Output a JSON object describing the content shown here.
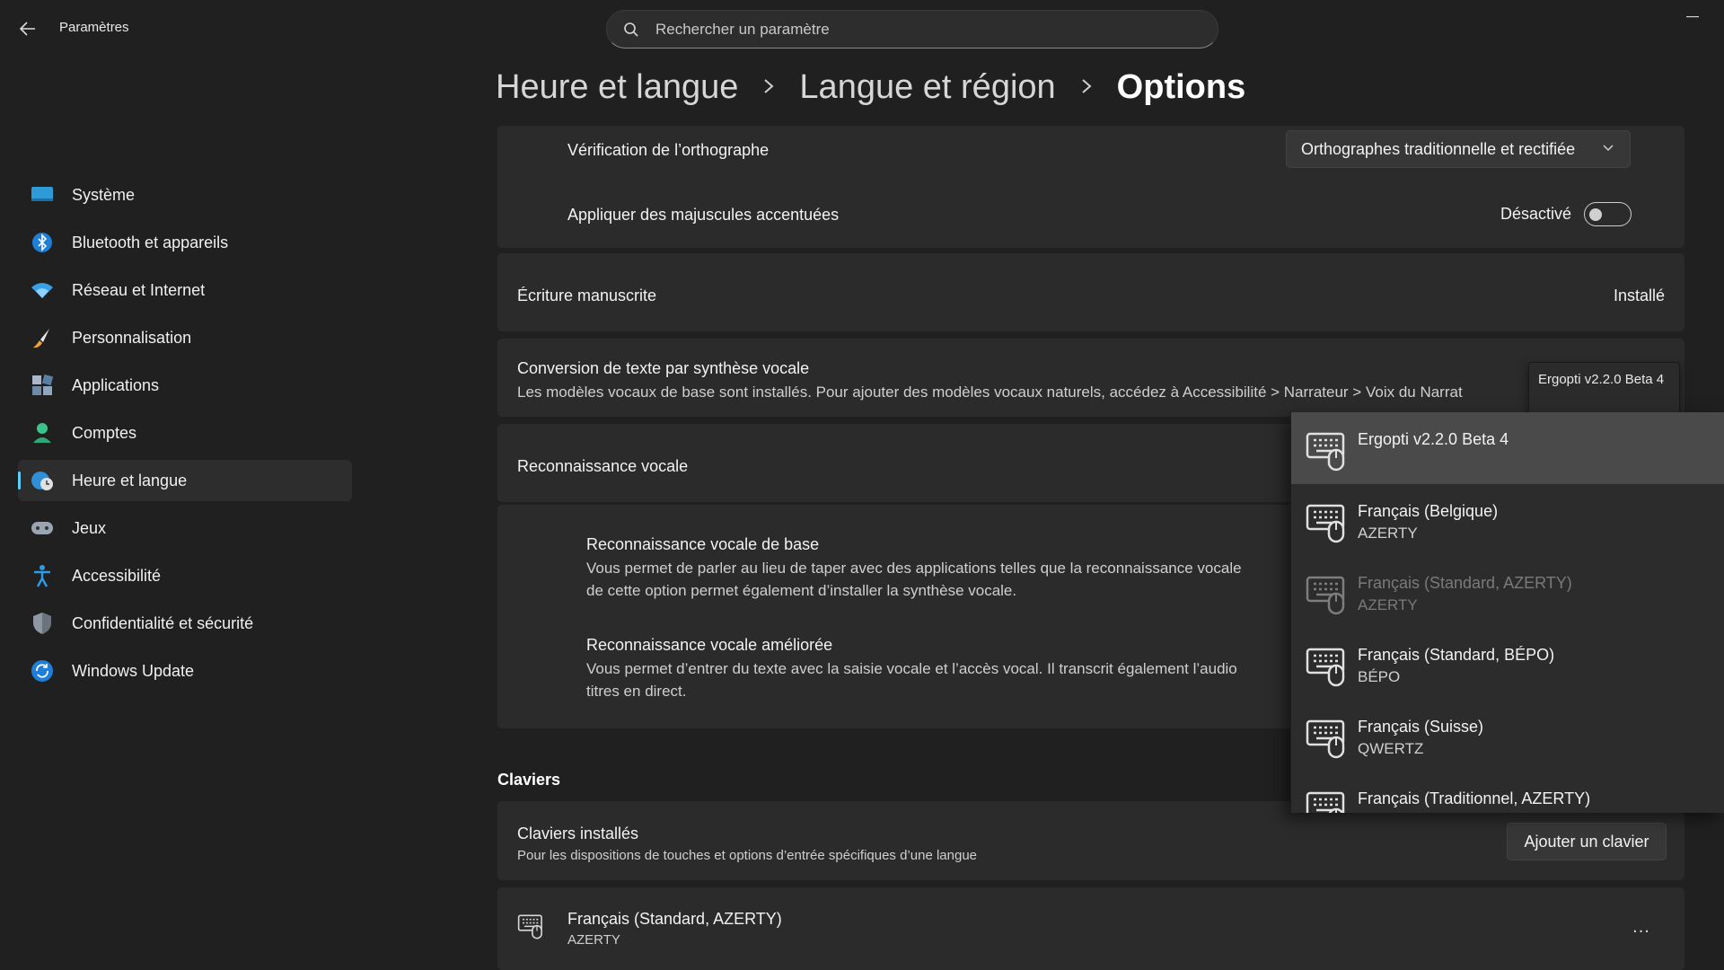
{
  "app": {
    "title": "Paramètres"
  },
  "search": {
    "placeholder": "Rechercher un paramètre"
  },
  "sidebar": {
    "items": [
      {
        "label": "Système",
        "icon": "monitor-icon"
      },
      {
        "label": "Bluetooth et appareils",
        "icon": "bluetooth-icon"
      },
      {
        "label": "Réseau et Internet",
        "icon": "wifi-icon"
      },
      {
        "label": "Personnalisation",
        "icon": "brush-icon"
      },
      {
        "label": "Applications",
        "icon": "apps-icon"
      },
      {
        "label": "Comptes",
        "icon": "user-icon"
      },
      {
        "label": "Heure et langue",
        "icon": "globe-clock-icon",
        "active": true
      },
      {
        "label": "Jeux",
        "icon": "gamepad-icon"
      },
      {
        "label": "Accessibilité",
        "icon": "accessibility-icon"
      },
      {
        "label": "Confidentialité et sécurité",
        "icon": "shield-icon"
      },
      {
        "label": "Windows Update",
        "icon": "update-icon"
      }
    ]
  },
  "breadcrumb": {
    "level1": "Heure et langue",
    "level2": "Langue et région",
    "current": "Options"
  },
  "spellcheck": {
    "label": "Vérification de l’orthographe",
    "value": "Orthographes traditionnelle et rectifiée"
  },
  "accented_caps": {
    "label": "Appliquer des majuscules accentuées",
    "state": "Désactivé",
    "on": false
  },
  "handwriting": {
    "label": "Écriture manuscrite",
    "status": "Installé"
  },
  "tts": {
    "label": "Conversion de texte par synthèse vocale",
    "desc": "Les modèles vocaux de base sont installés. Pour ajouter des modèles vocaux naturels, accédez à Accessibilité > Narrateur > Voix du Narrat"
  },
  "speech": {
    "label": "Reconnaissance vocale",
    "basic": {
      "title": "Reconnaissance vocale de base",
      "line1": "Vous permet de parler au lieu de taper avec des applications telles que la reconnaissance vocale",
      "line2": "de cette option permet également d’installer la synthèse vocale."
    },
    "enhanced": {
      "title": "Reconnaissance vocale améliorée",
      "line1": "Vous permet d’entrer du texte avec la saisie vocale et l’accès vocal. Il transcrit également l’audio",
      "line2": "titres en direct."
    }
  },
  "keyboards": {
    "section": "Claviers",
    "installed_label": "Claviers installés",
    "installed_desc": "Pour les dispositions de touches et options d’entrée spécifiques d’une langue",
    "add_button": "Ajouter un clavier",
    "item": {
      "name": "Français (Standard, AZERTY)",
      "layout": "AZERTY"
    },
    "more": "..."
  },
  "tooltip": {
    "text": "Ergopti v2.2.0 Beta 4"
  },
  "popup": {
    "items": [
      {
        "name": "Ergopti v2.2.0 Beta 4",
        "layout": "",
        "state": "selected"
      },
      {
        "name": "Français (Belgique)",
        "layout": "AZERTY",
        "state": "normal"
      },
      {
        "name": "Français (Standard, AZERTY)",
        "layout": "AZERTY",
        "state": "disabled"
      },
      {
        "name": "Français (Standard, BÉPO)",
        "layout": "BÉPO",
        "state": "normal"
      },
      {
        "name": "Français (Suisse)",
        "layout": "QWERTZ",
        "state": "normal"
      },
      {
        "name": "Français (Traditionnel, AZERTY)",
        "layout": "",
        "state": "normal"
      }
    ]
  },
  "colors": {
    "accent": "#60cdff",
    "background": "#202020",
    "card": "#2b2b2b"
  }
}
